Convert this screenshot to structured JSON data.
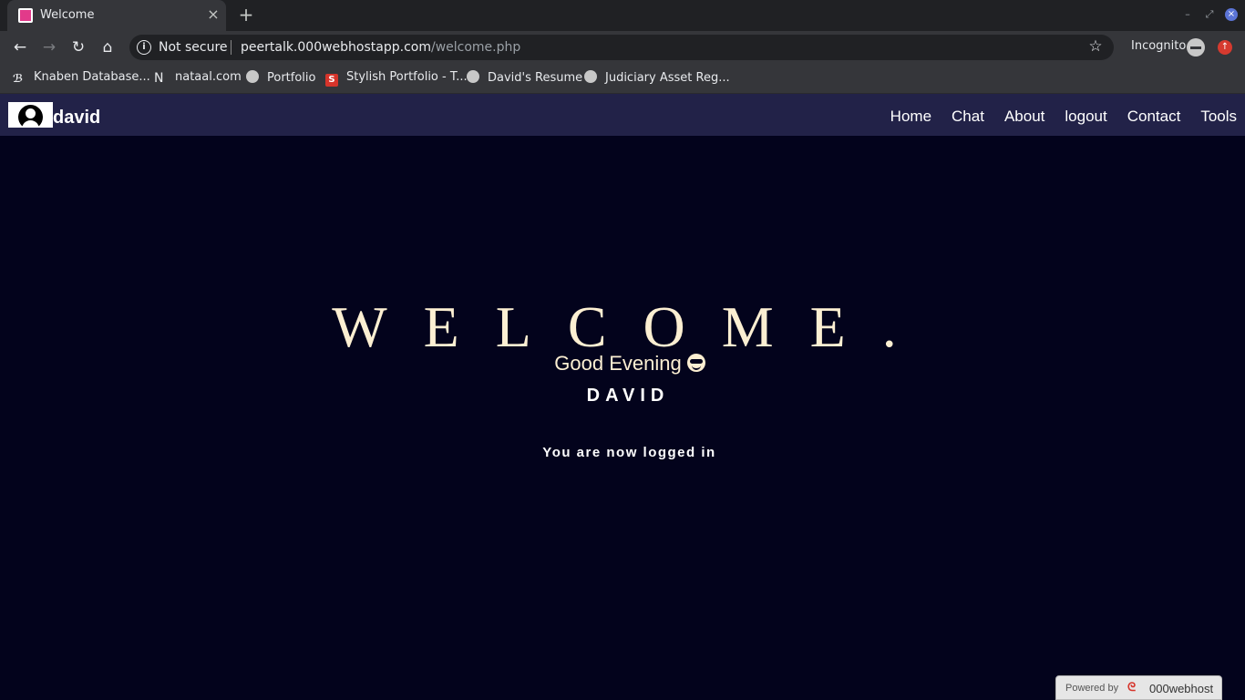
{
  "browser": {
    "tab_title": "Welcome",
    "tab_close": "×",
    "new_tab": "+",
    "minimize": "–",
    "restore": "⤢",
    "close": "×",
    "back": "←",
    "forward": "→",
    "reload": "↻",
    "home": "⌂",
    "info": "i",
    "not_secure": "Not secure",
    "url_host": "peertalk.000webhostapp.com",
    "url_path": "/welcome.php",
    "star": "☆",
    "incognito_label": "Incognito",
    "ext_icon": "↑"
  },
  "bookmarks": [
    {
      "label": "Knaben Database...",
      "icon": "knaben-icon"
    },
    {
      "label": "nataal.com",
      "icon": "n-icon"
    },
    {
      "label": "Portfolio",
      "icon": "globe-icon"
    },
    {
      "label": "Stylish Portfolio - T...",
      "icon": "s-icon"
    },
    {
      "label": "David's Resume",
      "icon": "globe-icon"
    },
    {
      "label": "Judiciary Asset Reg...",
      "icon": "globe-icon"
    }
  ],
  "bookmark_glyphs": {
    "knaben": "ℬ",
    "n": "N",
    "s": "S"
  },
  "site": {
    "username": "david",
    "menu": [
      "Home",
      "Chat",
      "About",
      "logout",
      "Contact",
      "Tools"
    ]
  },
  "main": {
    "welcome": "WELCOME.",
    "greeting": "Good Evening",
    "name_caps": "DAVID",
    "status": "You are now logged in"
  },
  "footer": {
    "powered_label": "Powered by",
    "brand": "000webhost"
  },
  "colors": {
    "page_bg": "#03031c",
    "nav_bg": "#222248",
    "welcome_text": "#fcefd2"
  }
}
